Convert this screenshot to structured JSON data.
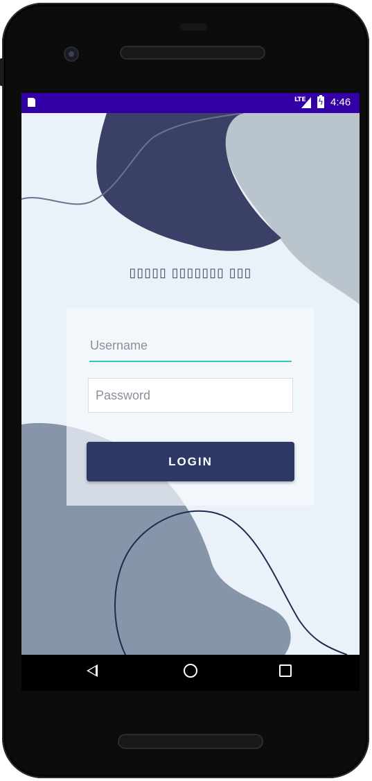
{
  "status_bar": {
    "network": "LTE",
    "time": "4:46"
  },
  "app": {
    "title": "▯▯▯▯▯ ▯▯▯▯▯▯▯ ▯▯▯",
    "username_placeholder": "Username",
    "password_placeholder": "Password",
    "login_label": "LOGIN"
  },
  "colors": {
    "status_bar": "#3300a6",
    "background": "#eaf1f8",
    "button": "#2d3865",
    "input_underline": "#2fc9b8"
  }
}
